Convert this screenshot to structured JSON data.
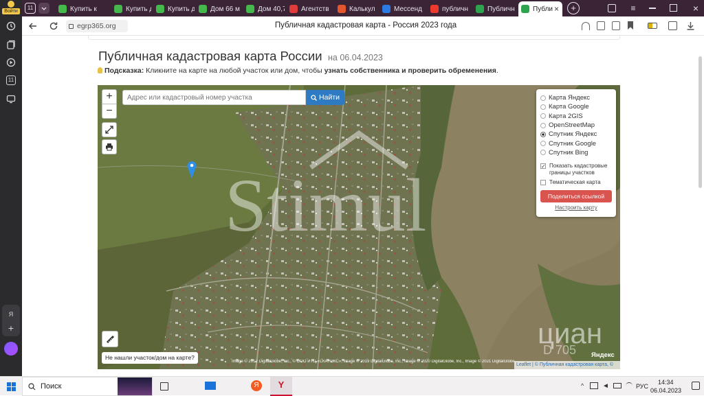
{
  "sidebar": {
    "login_label": "Войти",
    "tabs_count_badge": "11"
  },
  "tabs": [
    {
      "label": "Купить к",
      "icon": "cian-favicon",
      "color": "#44b84a"
    },
    {
      "label": "Купить д",
      "icon": "cian-favicon",
      "color": "#44b84a"
    },
    {
      "label": "Купить д",
      "icon": "cian-favicon",
      "color": "#44b84a"
    },
    {
      "label": "Дом 66 м",
      "icon": "cian-favicon",
      "color": "#44b84a"
    },
    {
      "label": "Дом 40,7",
      "icon": "cian-favicon",
      "color": "#44b84a"
    },
    {
      "label": "Агентств",
      "icon": "agency-favicon",
      "color": "#e23b3b"
    },
    {
      "label": "Калькул",
      "icon": "calc-favicon",
      "color": "#e4572e"
    },
    {
      "label": "Мессенд",
      "icon": "messenger-favicon",
      "color": "#2c7be5"
    },
    {
      "label": "публичн",
      "icon": "yandex-favicon",
      "color": "#ec3b2e"
    },
    {
      "label": "Публичн",
      "icon": "egrp-favicon",
      "color": "#2fa44f"
    },
    {
      "label": "Публи",
      "icon": "egrp-favicon",
      "color": "#2fa44f",
      "active": true
    }
  ],
  "address_bar": {
    "url": "egrp365.org",
    "page_title": "Публичная кадастровая карта - Россия 2023 года"
  },
  "page": {
    "heading": "Публичная кадастровая карта России",
    "date_suffix": "на 06.04.2023",
    "hint_label": "Подсказка:",
    "hint_text": " Кликните на карте на любой участок или дом, чтобы ",
    "hint_bold": "узнать собственника и проверить обременения",
    "hint_end": "."
  },
  "map": {
    "search_placeholder": "Адрес или кадастровый номер участка",
    "search_button": "Найти",
    "zoom_in": "+",
    "zoom_out": "−",
    "layers": [
      {
        "label": "Карта Яндекс",
        "selected": false
      },
      {
        "label": "Карта Google",
        "selected": false
      },
      {
        "label": "Карта 2GIS",
        "selected": false
      },
      {
        "label": "OpenStreetMap",
        "selected": false
      },
      {
        "label": "Спутник Яндекс",
        "selected": true
      },
      {
        "label": "Спутник Google",
        "selected": false
      },
      {
        "label": "Спутник Bing",
        "selected": false
      }
    ],
    "show_boundaries_label": "Показать кадастровые границы участков",
    "show_boundaries_checked": true,
    "thematic_label": "Тематическая карта",
    "thematic_checked": false,
    "share_button": "Поделиться ссылкой",
    "configure_link": "Настроить карту",
    "not_found_button": "Не нашли участок/дом на карте?",
    "attribution": "Image © 2012 DigitalGlobe, Inc., © ООО ИТЦ «СКАНЭКС», Image © 2019 DigitalGlobe, Inc., Image © 2020 DigitalGlobe, Inc., Image © 2021 DigitalGlobe",
    "yandex_label": "Яндекс",
    "leaflet_credit": "Leaflet | © Публичная кадастровая карта, ©",
    "watermark": "Stimul",
    "cian_watermark": "циан",
    "cian_number": "D 705"
  },
  "taskbar": {
    "search_label": "Поиск",
    "language": "РУС",
    "time": "14:34",
    "date": "06.04.2023"
  },
  "colors": {
    "tab_strip": "#3a2436",
    "accent_blue": "#2f7bc3",
    "share_red": "#d9534f",
    "river": "#8d8262"
  }
}
